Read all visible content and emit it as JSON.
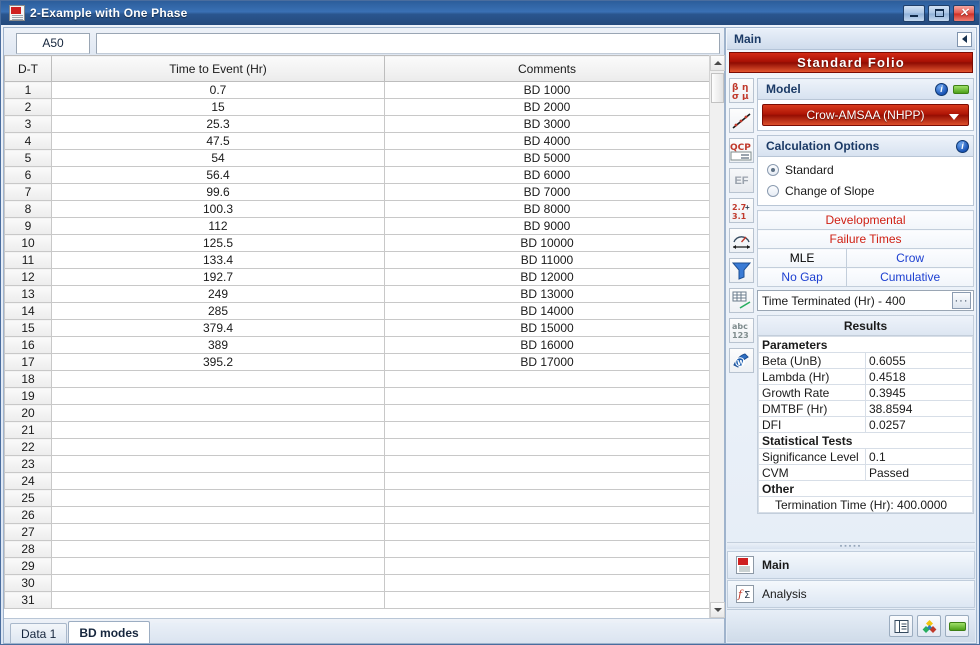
{
  "window": {
    "title": "2-Example with One Phase",
    "icon": "rga-app-icon",
    "buttons": {
      "minimize": "_",
      "maximize": "□",
      "close": "×"
    }
  },
  "formula_bar": {
    "cell_ref": "A50",
    "formula_value": "",
    "formula_placeholder": ""
  },
  "grid": {
    "columns": [
      "D-T",
      "Time to Event (Hr)",
      "Comments"
    ],
    "rows": [
      {
        "n": "1",
        "time": "0.7",
        "comment": "BD 1000"
      },
      {
        "n": "2",
        "time": "15",
        "comment": "BD 2000"
      },
      {
        "n": "3",
        "time": "25.3",
        "comment": "BD 3000"
      },
      {
        "n": "4",
        "time": "47.5",
        "comment": "BD 4000"
      },
      {
        "n": "5",
        "time": "54",
        "comment": "BD 5000"
      },
      {
        "n": "6",
        "time": "56.4",
        "comment": "BD 6000"
      },
      {
        "n": "7",
        "time": "99.6",
        "comment": "BD 7000"
      },
      {
        "n": "8",
        "time": "100.3",
        "comment": "BD 8000"
      },
      {
        "n": "9",
        "time": "112",
        "comment": "BD 9000"
      },
      {
        "n": "10",
        "time": "125.5",
        "comment": "BD 10000"
      },
      {
        "n": "11",
        "time": "133.4",
        "comment": "BD 11000"
      },
      {
        "n": "12",
        "time": "192.7",
        "comment": "BD 12000"
      },
      {
        "n": "13",
        "time": "249",
        "comment": "BD 13000"
      },
      {
        "n": "14",
        "time": "285",
        "comment": "BD 14000"
      },
      {
        "n": "15",
        "time": "379.4",
        "comment": "BD 15000"
      },
      {
        "n": "16",
        "time": "389",
        "comment": "BD 16000"
      },
      {
        "n": "17",
        "time": "395.2",
        "comment": "BD 17000"
      },
      {
        "n": "18",
        "time": "",
        "comment": ""
      },
      {
        "n": "19",
        "time": "",
        "comment": ""
      },
      {
        "n": "20",
        "time": "",
        "comment": ""
      },
      {
        "n": "21",
        "time": "",
        "comment": ""
      },
      {
        "n": "22",
        "time": "",
        "comment": ""
      },
      {
        "n": "23",
        "time": "",
        "comment": ""
      },
      {
        "n": "24",
        "time": "",
        "comment": ""
      },
      {
        "n": "25",
        "time": "",
        "comment": ""
      },
      {
        "n": "26",
        "time": "",
        "comment": ""
      },
      {
        "n": "27",
        "time": "",
        "comment": ""
      },
      {
        "n": "28",
        "time": "",
        "comment": ""
      },
      {
        "n": "29",
        "time": "",
        "comment": ""
      },
      {
        "n": "30",
        "time": "",
        "comment": ""
      },
      {
        "n": "31",
        "time": "",
        "comment": ""
      }
    ]
  },
  "sheet_tabs": [
    {
      "label": "Data 1",
      "active": false
    },
    {
      "label": "BD modes",
      "active": true
    }
  ],
  "panel": {
    "header_title": "Main",
    "banner": "Standard Folio",
    "icon_rail": [
      "parameters-icon",
      "plot-icon",
      "qcp-icon",
      "ef-icon",
      "precision-icon",
      "gauge-icon",
      "filter-icon",
      "transpose-icon",
      "abc-icon",
      "word-report-icon"
    ],
    "model": {
      "header": "Model",
      "info_icon": "info-icon",
      "green_icon": "green-bar-icon",
      "selected": "Crow-AMSAA (NHPP)",
      "caret": "chevron-down-icon"
    },
    "calculation_options": {
      "header": "Calculation Options",
      "info_icon": "info-icon",
      "options": [
        {
          "label": "Standard",
          "selected": true
        },
        {
          "label": "Change of Slope",
          "selected": false
        }
      ]
    },
    "strip": {
      "row1": "Developmental",
      "row2": "Failure Times",
      "row3_left": "MLE",
      "row3_right": "Crow",
      "row4_left": "No Gap",
      "row4_right": "Cumulative"
    },
    "termination": {
      "value": "Time Terminated (Hr) - 400",
      "browse_label": "···"
    },
    "results": {
      "title": "Results",
      "sections": [
        {
          "type": "section",
          "label": "Parameters"
        },
        {
          "type": "row",
          "label": "Beta (UnB)",
          "value": "0.6055"
        },
        {
          "type": "row",
          "label": "Lambda (Hr)",
          "value": "0.4518"
        },
        {
          "type": "row",
          "label": "Growth Rate",
          "value": "0.3945"
        },
        {
          "type": "row",
          "label": "DMTBF (Hr)",
          "value": "38.8594"
        },
        {
          "type": "row",
          "label": "DFI",
          "value": "0.0257"
        },
        {
          "type": "section",
          "label": "Statistical Tests"
        },
        {
          "type": "row",
          "label": "Significance Level",
          "value": "0.1"
        },
        {
          "type": "row",
          "label": "CVM",
          "value": "Passed"
        },
        {
          "type": "section",
          "label": "Other"
        },
        {
          "type": "indent",
          "label": "Termination Time (Hr): 400.0000",
          "value": ""
        }
      ]
    },
    "nav": [
      {
        "label": "Main",
        "icon": "rga-main-icon",
        "selected": true
      },
      {
        "label": "Analysis",
        "icon": "analysis-icon",
        "selected": false
      }
    ],
    "footer_buttons": [
      "sheet-view-icon",
      "colors-icon",
      "green-bar-icon"
    ]
  },
  "colors": {
    "titlebar": "#2c5d9b",
    "banner_red": "#a81105",
    "model_red": "#b01606",
    "strip_red": "#cf1f12",
    "strip_blue": "#1c3fd1"
  }
}
